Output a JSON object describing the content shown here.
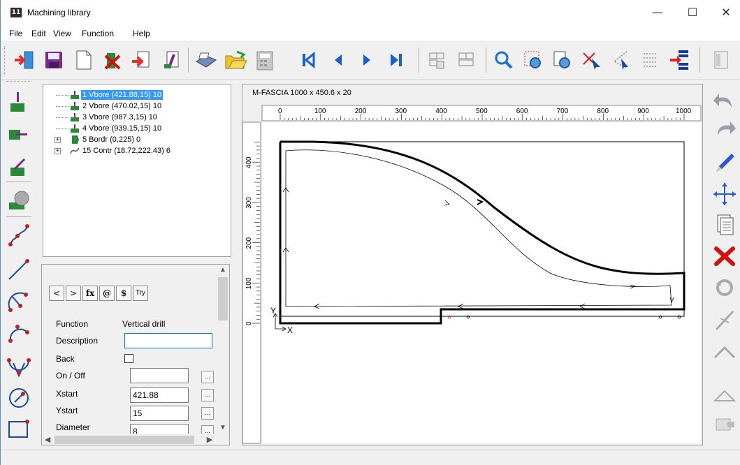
{
  "window": {
    "title": "Machining library",
    "icon_text": "11",
    "minimize_glyph": "—",
    "maximize_glyph": "☐",
    "close_glyph": "✕"
  },
  "menu": [
    "File",
    "Edit",
    "View",
    "Function",
    "Help"
  ],
  "toolbar": [
    {
      "icon": "import-icon"
    },
    {
      "icon": "save-icon"
    },
    {
      "icon": "new-icon"
    },
    {
      "icon": "delete-program-icon"
    },
    {
      "icon": "export-icon"
    },
    {
      "icon": "tool-setup-icon"
    },
    {
      "icon": "print-icon"
    },
    {
      "icon": "open-folder-icon"
    },
    {
      "icon": "calculator-icon"
    },
    {
      "icon": "first-icon"
    },
    {
      "icon": "previous-icon"
    },
    {
      "icon": "next-icon"
    },
    {
      "icon": "last-icon"
    },
    {
      "icon": "multi-select-icon"
    },
    {
      "icon": "multi-select-2-icon"
    },
    {
      "icon": "zoom-icon"
    },
    {
      "icon": "zoom-window-icon"
    },
    {
      "icon": "zoom-pages-icon"
    },
    {
      "icon": "select-arrow-icon"
    },
    {
      "icon": "select-arrow-2-icon"
    },
    {
      "icon": "grid-icon"
    },
    {
      "icon": "list-insert-icon"
    },
    {
      "icon": "panel-icon"
    }
  ],
  "tree": {
    "items": [
      {
        "label": "1 Vbore  (421.88,15) 10",
        "selected": true,
        "icon": "vertical-bore-icon",
        "expander": ""
      },
      {
        "label": "2 Vbore  (470.02,15) 10",
        "selected": false,
        "icon": "vertical-bore-icon",
        "expander": ""
      },
      {
        "label": "3 Vbore  (987.3,15) 10",
        "selected": false,
        "icon": "vertical-bore-icon",
        "expander": ""
      },
      {
        "label": "4 Vbore  (939.15,15) 10",
        "selected": false,
        "icon": "vertical-bore-icon",
        "expander": ""
      },
      {
        "label": "5 Bordr  (0,225) 0",
        "selected": false,
        "icon": "border-icon",
        "expander": "+"
      },
      {
        "label": "15 Contr  (18.72,222.43) 6",
        "selected": false,
        "icon": "contour-icon",
        "expander": "+"
      }
    ]
  },
  "props": {
    "nav_buttons": [
      "<",
      ">",
      "fx",
      "@",
      "$",
      "Try"
    ],
    "function_label": "Function",
    "function_value": "Vertical drill",
    "description_label": "Description",
    "description_value": "",
    "back_label": "Back",
    "onoff_label": "On / Off",
    "onoff_value": "",
    "xstart_label": "Xstart",
    "xstart_value": "421.88",
    "ystart_label": "Ystart",
    "ystart_value": "15",
    "diameter_label": "Diameter",
    "diameter_value": "8",
    "dots": "..."
  },
  "drawing": {
    "header": "M-FASCIA  1000 x 450.6 x 20",
    "x_ticks": [
      "0",
      "100",
      "200",
      "300",
      "400",
      "500",
      "600",
      "700",
      "800",
      "900",
      "1000"
    ],
    "y_ticks": [
      "400",
      "300",
      "200",
      "100",
      "0"
    ],
    "axis_x": "X",
    "axis_y": "Y"
  }
}
